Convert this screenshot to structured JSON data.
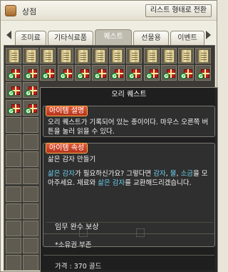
{
  "window": {
    "title": "상점",
    "view_mode_button": "리스트 형태로 전환"
  },
  "tabs": [
    {
      "label": "조미료",
      "active": false
    },
    {
      "label": "기타식료품",
      "active": false
    },
    {
      "label": "퀘스트",
      "active": true
    },
    {
      "label": "선물용",
      "active": false
    },
    {
      "label": "이벤트",
      "active": false
    }
  ],
  "grid": {
    "row_items": [
      "scroll",
      "gift",
      "gift",
      "gift"
    ]
  },
  "tooltip": {
    "item_name": "오리 퀘스트",
    "description_header": "아이템 설명",
    "description_text": "오리 퀘스트가 기록되어 있는 종이이다. 마우스 오른쪽 버튼을 눌러 읽을 수 있다.",
    "attributes_header": "아이템 속성",
    "attributes_line1": "삶은 감자 만들기",
    "attr_seg1": "삶은 감자",
    "attr_seg2": "가 필요하신가요? 그렇다면 ",
    "attr_seg3": "감자",
    "attr_seg4": ", ",
    "attr_seg5": "물",
    "attr_seg6": ", ",
    "attr_seg7": "소금",
    "attr_seg8": "을 모아주세요. 재료와 ",
    "attr_seg9": "삶은 감자",
    "attr_seg10": "를 교환해드리겠습니다.",
    "reward_label": "임무 완수 보상",
    "note": "*소유권 부존",
    "price": "가격 : 370 골드"
  },
  "colors": {
    "highlight": "#6bd0ee",
    "header_red": "#c8401f",
    "tab_active": "#bfbcaf"
  }
}
